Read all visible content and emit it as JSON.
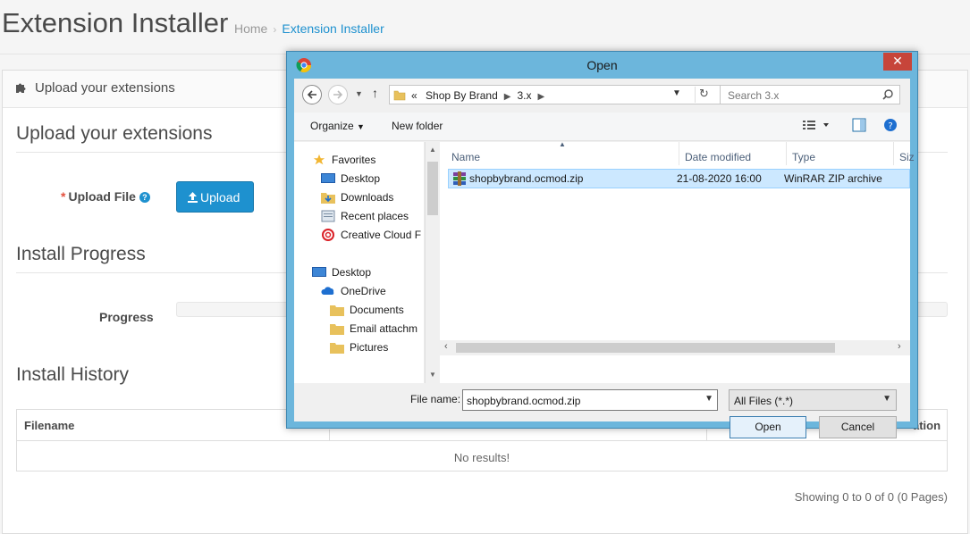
{
  "page": {
    "title": "Extension Installer",
    "breadcrumb": {
      "home": "Home",
      "separator": "›",
      "current": "Extension Installer"
    },
    "panel_heading": "Upload your extensions",
    "upload_section": {
      "legend": "Upload your extensions",
      "field_label": "Upload File",
      "required_mark": "*",
      "help_glyph": "?",
      "button_label": "Upload"
    },
    "progress_section": {
      "legend": "Install Progress",
      "field_label": "Progress",
      "progress": 0
    },
    "history_section": {
      "legend": "Install History",
      "columns": [
        "Filename",
        "",
        "ation"
      ],
      "empty_text": "No results!",
      "pagination": "Showing 0 to 0 of 0 (0 Pages)"
    }
  },
  "dialog": {
    "title": "Open",
    "close_glyph": "✕",
    "address": {
      "prefix": "«",
      "path": [
        "Shop By Brand",
        "3.x"
      ]
    },
    "search_placeholder": "Search 3.x",
    "toolbar": {
      "organize": "Organize",
      "new_folder": "New folder"
    },
    "nav": {
      "favorites": "Favorites",
      "favorites_items": [
        "Desktop",
        "Downloads",
        "Recent places",
        "Creative Cloud F"
      ],
      "desktop": "Desktop",
      "onedrive": "OneDrive",
      "onedrive_items": [
        "Documents",
        "Email attachm",
        "Pictures"
      ]
    },
    "columns": [
      "Name",
      "Date modified",
      "Type",
      "Siz"
    ],
    "files": [
      {
        "name": "shopbybrand.ocmod.zip",
        "date": "21-08-2020 16:00",
        "type": "WinRAR ZIP archive"
      }
    ],
    "file_name_label": "File name:",
    "file_name_value": "shopbybrand.ocmod.zip",
    "filter_value": "All Files (*.*)",
    "open_label": "Open",
    "cancel_label": "Cancel",
    "colors": {
      "titlebar": "#6cb6dc",
      "selection": "#cce8ff",
      "accent": "#1e91cf"
    }
  }
}
